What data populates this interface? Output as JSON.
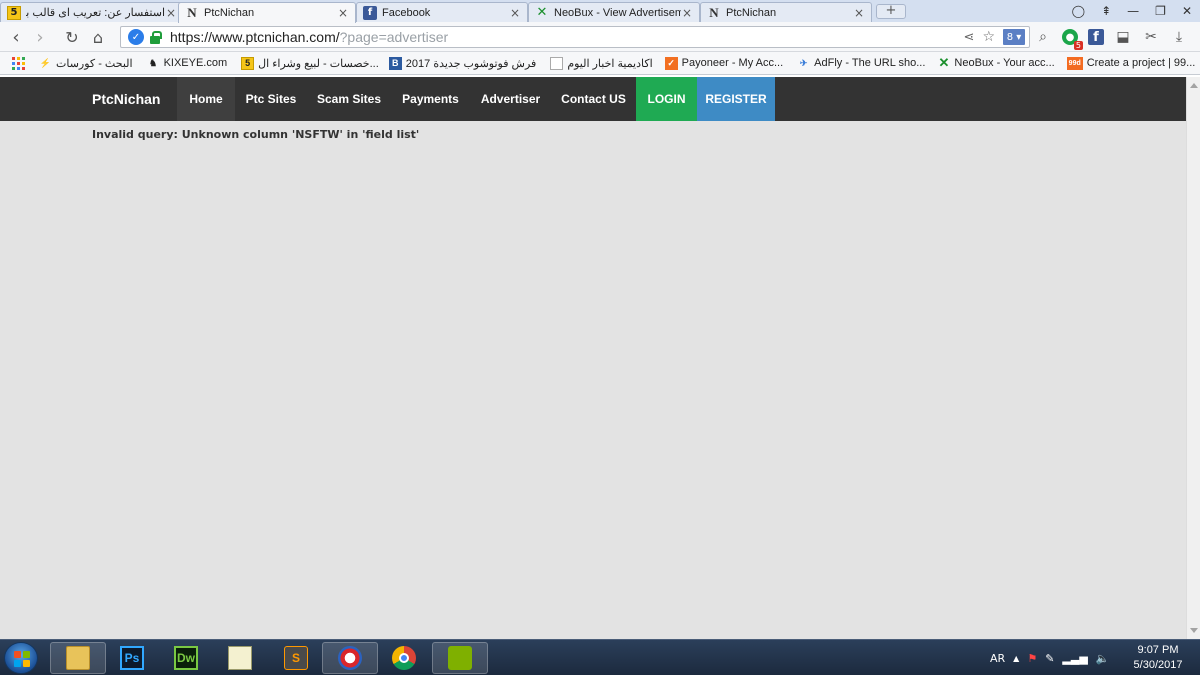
{
  "browser": {
    "tabs": [
      {
        "title": "استفسار عن: تعريب اى قالب بل...",
        "favicon": "five-icon",
        "close": "×"
      },
      {
        "title": "PtcNichan",
        "favicon": "n-icon",
        "close": "×"
      },
      {
        "title": "Facebook",
        "favicon": "facebook-icon",
        "close": "×"
      },
      {
        "title": "NeoBux - View Advertisem",
        "favicon": "neobux-icon",
        "close": "×"
      },
      {
        "title": "PtcNichan",
        "favicon": "n-icon",
        "close": "×"
      }
    ],
    "new_tab": "+",
    "url": {
      "host": "https://www.ptcnichan.com/",
      "path": "?page=advertiser"
    },
    "search_engine_label": "8 ▾",
    "extension_badge": "5",
    "bookmarks": [
      {
        "label": "البحث - كورسات",
        "icon": "bookmark-lightning-icon"
      },
      {
        "label": "KIXEYE.com",
        "icon": "kixeye-icon"
      },
      {
        "label": "خصسات - لبيع وشراء ال...",
        "icon": "five-icon"
      },
      {
        "label": "فرش فوتوشوب جديدة 2017",
        "icon": "blogger-icon"
      },
      {
        "label": "اكاديمية اخبار اليوم",
        "icon": "page-icon"
      },
      {
        "label": "Payoneer - My Acc...",
        "icon": "payoneer-icon"
      },
      {
        "label": "AdFly - The URL sho...",
        "icon": "adfly-icon"
      },
      {
        "label": "NeoBux - Your acc...",
        "icon": "neobux-icon"
      },
      {
        "label": "Create a project | 99...",
        "icon": "99designs-icon"
      }
    ],
    "more_bookmarks": "»"
  },
  "site": {
    "brand": "PtcNichan",
    "nav": [
      {
        "label": "Home"
      },
      {
        "label": "Ptc Sites"
      },
      {
        "label": "Scam Sites"
      },
      {
        "label": "Payments"
      },
      {
        "label": "Advertiser"
      },
      {
        "label": "Contact US"
      }
    ],
    "login": "LOGIN",
    "register": "REGISTER",
    "error": "Invalid query: Unknown column 'NSFTW' in 'field list'"
  },
  "taskbar": {
    "apps": [
      {
        "name": "file-explorer",
        "label": ""
      },
      {
        "name": "photoshop",
        "label": "Ps"
      },
      {
        "name": "dreamweaver",
        "label": "Dw"
      },
      {
        "name": "notepad-plus-plus",
        "label": ""
      },
      {
        "name": "sublime-text",
        "label": "S"
      },
      {
        "name": "app-swirl",
        "label": ""
      },
      {
        "name": "chrome",
        "label": ""
      },
      {
        "name": "app-green",
        "label": ""
      }
    ],
    "language": "AR",
    "time": "9:07 PM",
    "date": "5/30/2017"
  },
  "colors": {
    "nav_bg": "#333333",
    "page_bg": "#e3e3e3",
    "login_bg": "#1faa53",
    "register_bg": "#3e8bc5"
  }
}
